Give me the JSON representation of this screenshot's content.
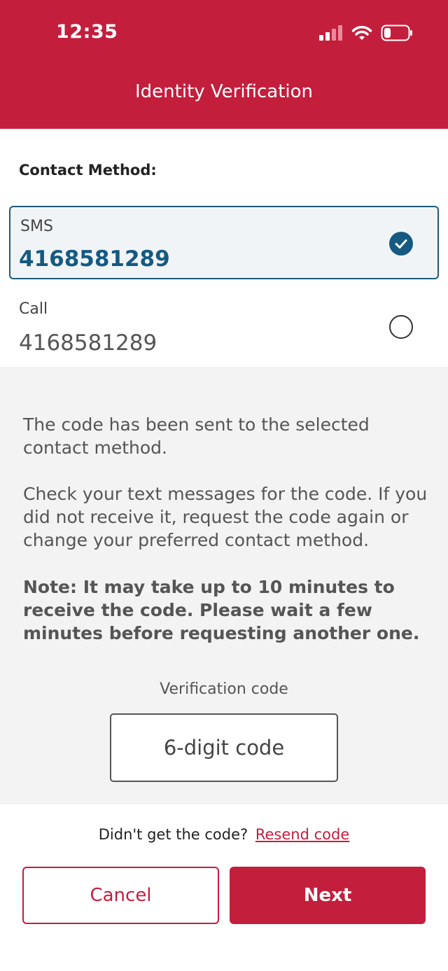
{
  "status_bar": {
    "time": "12:35",
    "icons": [
      "cellular-signal-icon",
      "wifi-icon",
      "battery-icon"
    ]
  },
  "header": {
    "title": "Identity Verification"
  },
  "contact": {
    "label": "Contact Method:",
    "options": [
      {
        "type": "SMS",
        "number": "4168581289",
        "selected": true
      },
      {
        "type": "Call",
        "number": "4168581289",
        "selected": false
      }
    ]
  },
  "info": {
    "paragraph1": "The code has been sent to the selected contact method.",
    "paragraph2": "Check your text messages for the code. If you did not receive it, request the code again or change your preferred contact method.",
    "note": "Note: It may take up to 10 minutes to receive the code. Please wait a few minutes before requesting another one."
  },
  "verification": {
    "label": "Verification code",
    "placeholder": "6-digit code",
    "value": ""
  },
  "resend": {
    "prompt": "Didn't get the code?",
    "link": "Resend code"
  },
  "buttons": {
    "cancel": "Cancel",
    "next": "Next"
  },
  "colors": {
    "brand_red": "#c41e3d",
    "selected_blue": "#155a80",
    "panel_gray": "#f3f3f3"
  }
}
